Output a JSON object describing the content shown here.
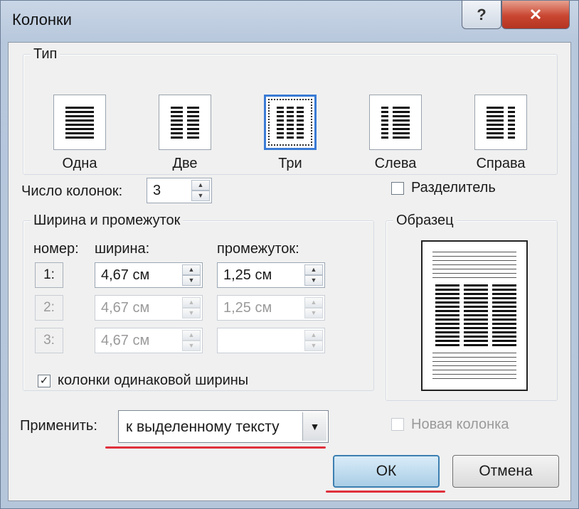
{
  "window": {
    "title": "Колонки",
    "help_label": "?",
    "close_label": "✕"
  },
  "type_group": {
    "label": "Тип",
    "presets": [
      {
        "label": "Одна"
      },
      {
        "label": "Две"
      },
      {
        "label": "Три",
        "selected": true
      },
      {
        "label": "Слева"
      },
      {
        "label": "Справа"
      }
    ]
  },
  "num_columns": {
    "label": "Число колонок:",
    "value": "3"
  },
  "separator": {
    "label": "Разделитель",
    "checked": false
  },
  "width_group": {
    "label": "Ширина и промежуток",
    "col_number": "номер:",
    "col_width": "ширина:",
    "col_spacing": "промежуток:",
    "rows": [
      {
        "number": "1:",
        "width": "4,67 см",
        "spacing": "1,25 см"
      },
      {
        "number": "2:",
        "width": "4,67 см",
        "spacing": "1,25 см"
      },
      {
        "number": "3:",
        "width": "4,67 см",
        "spacing": ""
      }
    ]
  },
  "equal_width": {
    "label": "колонки одинаковой ширины",
    "checked": true
  },
  "preview": {
    "label": "Образец"
  },
  "apply": {
    "label": "Применить:",
    "value": "к выделенному тексту"
  },
  "new_column": {
    "label": "Новая колонка",
    "checked": false
  },
  "buttons": {
    "ok": "ОК",
    "cancel": "Отмена"
  },
  "accent_color": "#e0303b"
}
